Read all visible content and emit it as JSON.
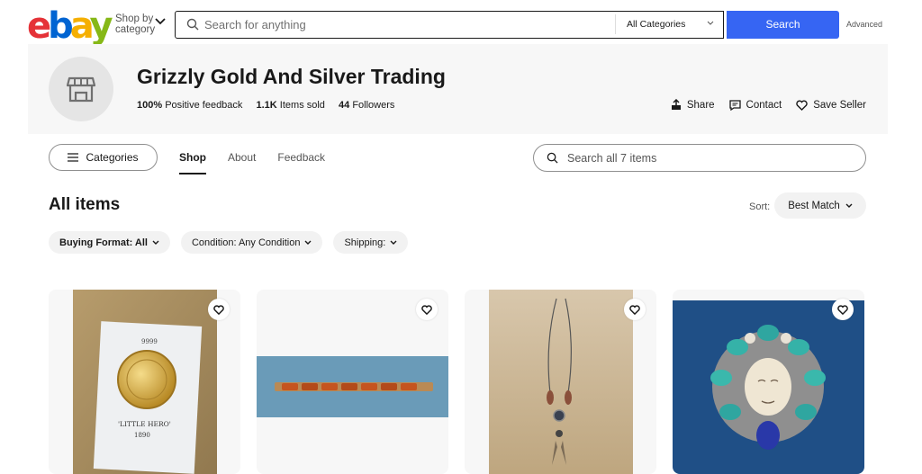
{
  "header": {
    "shop_by": "Shop by",
    "category": "category",
    "search_placeholder": "Search for anything",
    "category_select": "All Categories",
    "search_button": "Search",
    "advanced": "Advanced"
  },
  "seller": {
    "name": "Grizzly Gold And Silver Trading",
    "feedback_value": "100%",
    "feedback_label": "Positive feedback",
    "sold_value": "1.1K",
    "sold_label": "Items sold",
    "followers_value": "44",
    "followers_label": "Followers",
    "actions": {
      "share": "Share",
      "contact": "Contact",
      "save": "Save Seller"
    }
  },
  "nav": {
    "categories": "Categories",
    "tabs": [
      "Shop",
      "About",
      "Feedback"
    ],
    "store_search_placeholder": "Search all 7 items"
  },
  "listing": {
    "title": "All items",
    "sort_label": "Sort:",
    "sort_value": "Best Match",
    "filters": [
      "Buying Format: All",
      "Condition: Any Condition",
      "Shipping:"
    ]
  },
  "items": [
    {
      "image": "gold-coin-card",
      "coin_top": "9999",
      "coin_caption": "'LITTLE HERO'",
      "coin_year": "1890"
    },
    {
      "image": "amber-bracelet"
    },
    {
      "image": "silver-necklace"
    },
    {
      "image": "turquoise-face-brooch"
    }
  ],
  "colors": {
    "ebay_red": "#e53238",
    "ebay_blue": "#0064d2",
    "ebay_yellow": "#f5af02",
    "ebay_green": "#86b817",
    "search_blue": "#3665f3"
  }
}
